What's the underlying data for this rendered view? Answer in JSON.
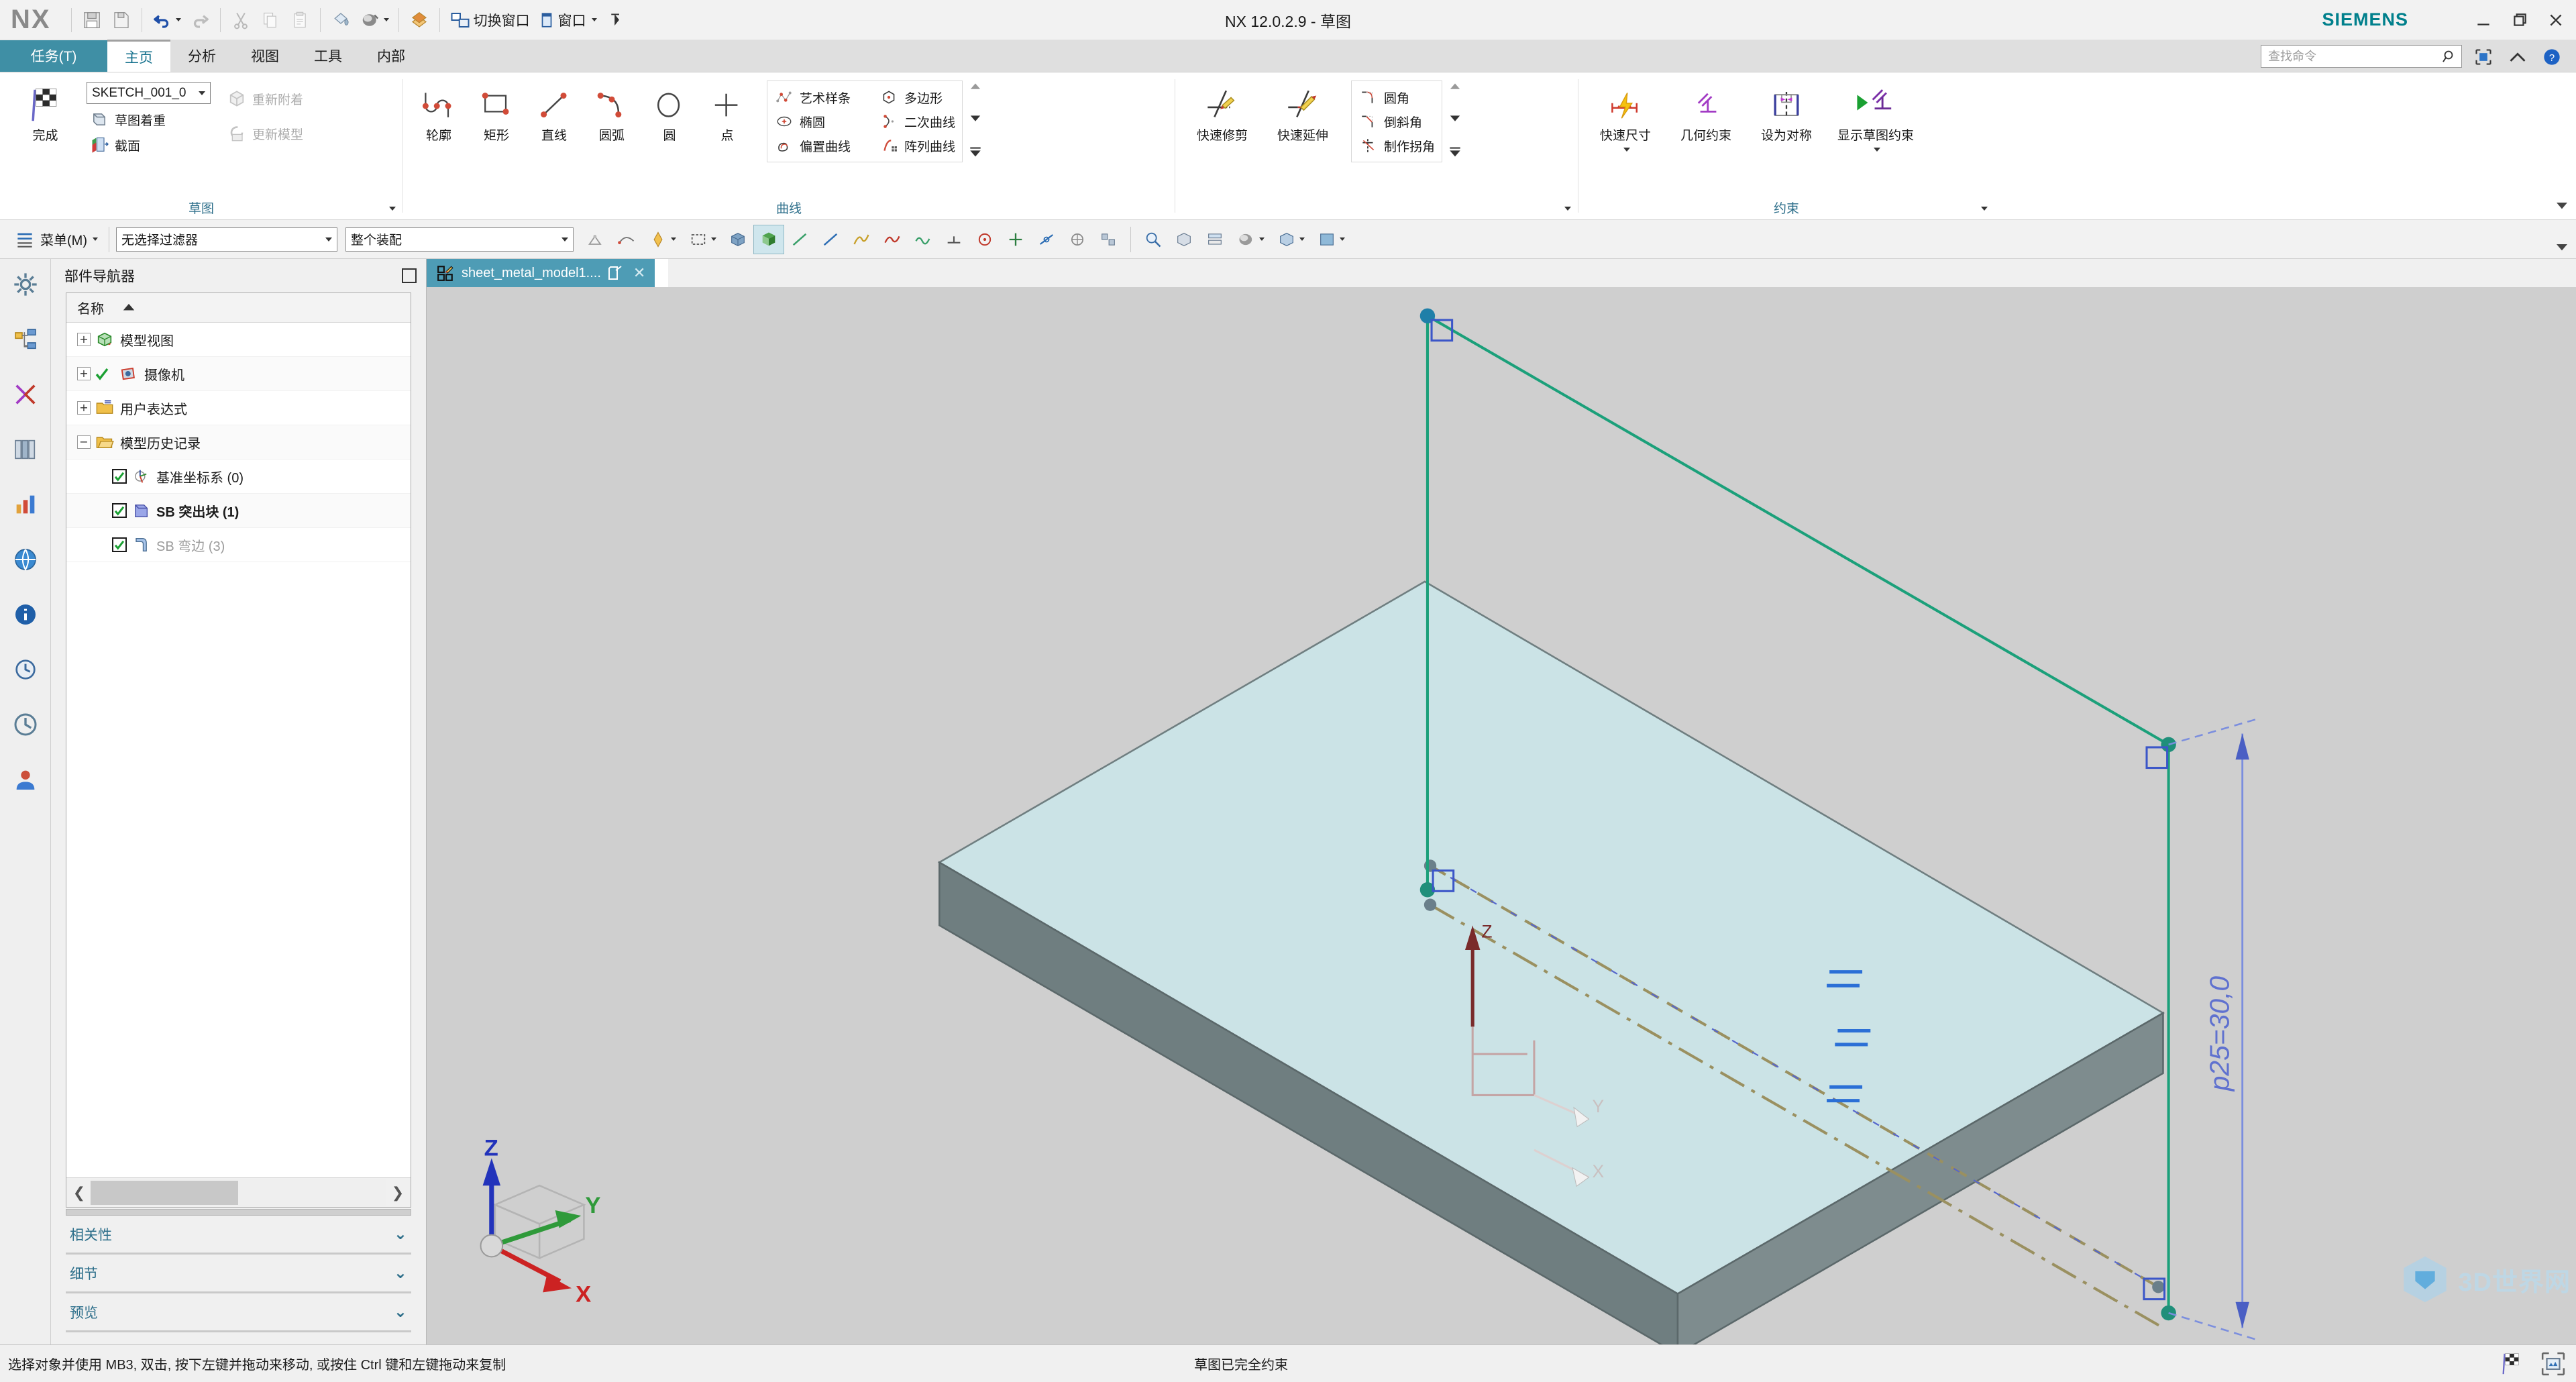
{
  "app": {
    "brand": "NX",
    "window_title": "NX 12.0.2.9 - 草图",
    "vendor": "SIEMENS"
  },
  "quick_access": {
    "items": [
      {
        "name": "save",
        "label": ""
      },
      {
        "name": "save-as",
        "label": ""
      },
      {
        "name": "undo",
        "label": ""
      },
      {
        "name": "redo",
        "label": ""
      },
      {
        "name": "cut",
        "label": ""
      },
      {
        "name": "copy",
        "label": ""
      },
      {
        "name": "paste",
        "label": ""
      },
      {
        "name": "paint-can",
        "label": ""
      },
      {
        "name": "render-style",
        "label": ""
      },
      {
        "name": "layer",
        "label": ""
      }
    ],
    "switch_window_label": "切换窗口",
    "window_label": "窗口"
  },
  "window_controls": {
    "minimize": "—",
    "restore": "❐",
    "close": "✕"
  },
  "ribbon_tabs": {
    "task_label": "任务(T)",
    "tabs": [
      {
        "label": "主页",
        "active": true
      },
      {
        "label": "分析",
        "active": false
      },
      {
        "label": "视图",
        "active": false
      },
      {
        "label": "工具",
        "active": false
      },
      {
        "label": "内部",
        "active": false
      }
    ],
    "search_placeholder": "查找命令",
    "right_icons": [
      "window-snapshot-icon",
      "collapse-ribbon-icon",
      "help-icon"
    ]
  },
  "ribbon": {
    "groups": [
      {
        "name": "sketch",
        "title": "草图",
        "finish_label": "完成",
        "combo_value": "SKETCH_001_0",
        "small_items": [
          {
            "label": "草图着重",
            "disabled": false
          },
          {
            "label": "截面",
            "disabled": false
          }
        ],
        "right_items": [
          {
            "label": "重新附着",
            "disabled": true
          },
          {
            "label": "更新模型",
            "disabled": true
          }
        ]
      },
      {
        "name": "curve",
        "title": "曲线",
        "big_items": [
          {
            "label": "轮廓",
            "icon": "profile-icon"
          },
          {
            "label": "矩形",
            "icon": "rectangle-icon"
          },
          {
            "label": "直线",
            "icon": "line-icon"
          },
          {
            "label": "圆弧",
            "icon": "arc-icon"
          },
          {
            "label": "圆",
            "icon": "circle-icon"
          },
          {
            "label": "点",
            "icon": "point-icon"
          }
        ],
        "gallery": [
          {
            "label": "艺术样条",
            "icon": "studio-spline-icon"
          },
          {
            "label": "多边形",
            "icon": "polygon-icon"
          },
          {
            "label": "椭圆",
            "icon": "ellipse-icon"
          },
          {
            "label": "二次曲线",
            "icon": "conic-icon"
          },
          {
            "label": "偏置曲线",
            "icon": "offset-curve-icon"
          },
          {
            "label": "阵列曲线",
            "icon": "pattern-curve-icon"
          }
        ]
      },
      {
        "name": "edit",
        "title": "",
        "big_items": [
          {
            "label": "快速修剪",
            "icon": "quick-trim-icon"
          },
          {
            "label": "快速延伸",
            "icon": "quick-extend-icon"
          }
        ],
        "gallery": [
          {
            "label": "圆角",
            "icon": "fillet-icon"
          },
          {
            "label": "倒斜角",
            "icon": "chamfer-icon"
          },
          {
            "label": "制作拐角",
            "icon": "make-corner-icon"
          }
        ]
      },
      {
        "name": "constraint",
        "title": "约束",
        "big_items": [
          {
            "label": "快速尺寸",
            "icon": "rapid-dimension-icon",
            "has_caret": true,
            "active": false
          },
          {
            "label": "几何约束",
            "icon": "geometric-constraint-icon",
            "has_caret": false,
            "active": false
          },
          {
            "label": "设为对称",
            "icon": "make-symmetric-icon",
            "has_caret": false,
            "active": false
          },
          {
            "label": "显示草图约束",
            "icon": "show-sketch-constraints-icon",
            "has_caret": true,
            "active": true
          }
        ]
      }
    ]
  },
  "toolbar2": {
    "menu_label": "菜单(M)",
    "selection_filter": "无选择过滤器",
    "scope": "整个装配",
    "icons": [
      "snap-point-icon",
      "curve-rule-icon",
      "select-feature-icon",
      "face-icon",
      "shaded-face-icon",
      "line-type-icon",
      "edge-icon",
      "curve-filter-icon",
      "spline-icon",
      "curve2-icon",
      "midpoint-icon",
      "center-icon",
      "intersection-icon",
      "tangent-icon",
      "quadrant-icon",
      "measure-icon",
      "display-icon",
      "layer-icon",
      "render-style-icon",
      "view-icon",
      "background-icon"
    ]
  },
  "resource_bar": {
    "items": [
      {
        "name": "assembly-navigator",
        "icon": "gear-icon"
      },
      {
        "name": "part-navigator",
        "icon": "tree-icon"
      },
      {
        "name": "constraint-navigator",
        "icon": "constraint-icon"
      },
      {
        "name": "reuse-library",
        "icon": "library-icon"
      },
      {
        "name": "hd3d-tools",
        "icon": "chart-icon"
      },
      {
        "name": "web-browser",
        "icon": "web-icon"
      },
      {
        "name": "history",
        "icon": "info-icon"
      },
      {
        "name": "process-studio",
        "icon": "process-icon"
      },
      {
        "name": "recent-items",
        "icon": "clock-icon"
      },
      {
        "name": "roles",
        "icon": "roles-icon"
      }
    ]
  },
  "navigator": {
    "title": "部件导航器",
    "column_header": "名称",
    "rows": [
      {
        "label": "模型视图",
        "expander": "+",
        "checkbox": false,
        "icon": "model-view-icon",
        "bold": false,
        "gray": false,
        "indent": 0
      },
      {
        "label": "摄像机",
        "expander": "+",
        "checkbox": false,
        "icon": "camera-icon",
        "check_mark": true,
        "bold": false,
        "gray": false,
        "indent": 0
      },
      {
        "label": "用户表达式",
        "expander": "+",
        "checkbox": false,
        "icon": "folder-icon",
        "bold": false,
        "gray": false,
        "indent": 0
      },
      {
        "label": "模型历史记录",
        "expander": "−",
        "checkbox": false,
        "icon": "folder-open-icon",
        "bold": false,
        "gray": false,
        "indent": 0
      },
      {
        "label": "基准坐标系 (0)",
        "expander": "",
        "checkbox": true,
        "icon": "datum-csys-icon",
        "bold": false,
        "gray": false,
        "indent": 1
      },
      {
        "label": "SB 突出块 (1)",
        "expander": "",
        "checkbox": true,
        "icon": "tab-feature-icon",
        "bold": true,
        "gray": false,
        "indent": 1
      },
      {
        "label": "SB 弯边 (3)",
        "expander": "",
        "checkbox": true,
        "icon": "flange-icon",
        "bold": false,
        "gray": true,
        "indent": 1
      }
    ],
    "sections": [
      {
        "label": "相关性"
      },
      {
        "label": "细节"
      },
      {
        "label": "预览"
      }
    ]
  },
  "document": {
    "tab_label": "sheet_metal_model1....",
    "tab_icon": "sketch-doc-icon",
    "modified_icon": "modified-icon",
    "close_icon": "close-icon"
  },
  "viewport": {
    "dimension_label": "p25=30,0",
    "triad": {
      "x": "X",
      "y": "Y",
      "z": "Z"
    },
    "sketch_axis_labels": {
      "z": "Z",
      "y": "Y",
      "x": "X"
    },
    "background_color": "#cfcfcf",
    "sheet_top_color": "#cbe3e6",
    "sheet_side_color": "#6f7e80",
    "sketch_curve_color": "#1ba07a",
    "dimension_color": "#7b8ede",
    "reference_color": "#9a9060"
  },
  "status": {
    "message": "选择对象并使用 MB3, 双击, 按下左键并拖动来移动, 或按住 Ctrl 键和左键拖动来复制",
    "sketch_state": "草图已完全约束",
    "right_icons": [
      "finish-sketch-icon",
      "snapshot-icon"
    ]
  },
  "watermark": {
    "text": "3D世界网"
  }
}
